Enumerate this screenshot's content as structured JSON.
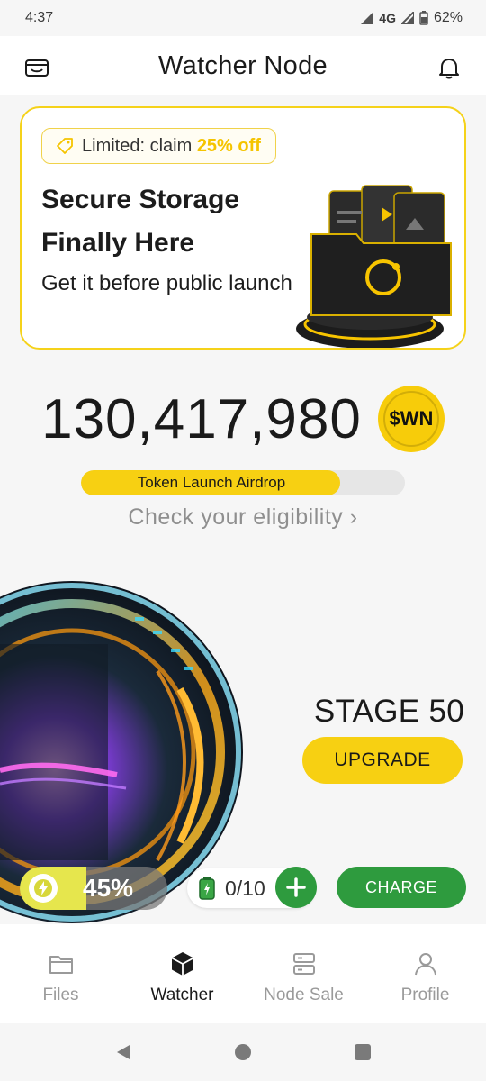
{
  "status_bar": {
    "time": "4:37",
    "network": "4G",
    "battery": "62%"
  },
  "header": {
    "title": "Watcher Node",
    "left_icon": "wallet-icon",
    "right_icon": "bell-icon"
  },
  "promo": {
    "tag_prefix": "Limited: claim ",
    "tag_highlight": "25% off",
    "title": "Secure Storage Finally Here",
    "subtitle": "Get it before public launch",
    "accent_color": "#f5d21a"
  },
  "balance": {
    "amount": "130,417,980",
    "token": "$WN"
  },
  "airdrop": {
    "label": "Token Launch Airdrop",
    "progress_fraction": 0.8,
    "cta": "Check your eligibility",
    "cta_chevron": "›"
  },
  "node": {
    "stage": "STAGE 50",
    "upgrade_label": "UPGRADE"
  },
  "energy": {
    "percent_text": "45%",
    "level_fraction": 0.45
  },
  "charges": {
    "text": "0/10",
    "charge_label": "CHARGE"
  },
  "bottom_nav": {
    "items": [
      {
        "label": "Files",
        "icon": "folder-icon",
        "active": false
      },
      {
        "label": "Watcher",
        "icon": "cube-icon",
        "active": true
      },
      {
        "label": "Node Sale",
        "icon": "server-icon",
        "active": false
      },
      {
        "label": "Profile",
        "icon": "person-icon",
        "active": false
      }
    ]
  },
  "colors": {
    "yellow": "#f7d012",
    "green": "#2e9b3e",
    "background": "#f6f6f6"
  }
}
